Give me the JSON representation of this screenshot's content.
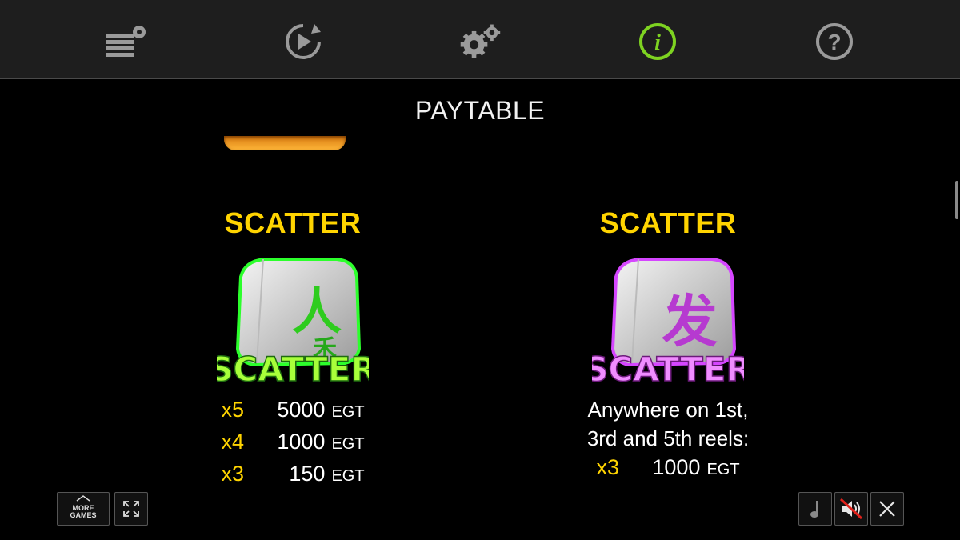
{
  "topbar": {
    "items": [
      {
        "name": "bet-settings-icon"
      },
      {
        "name": "autoplay-icon"
      },
      {
        "name": "settings-icon"
      },
      {
        "name": "info-icon",
        "active": true
      },
      {
        "name": "help-icon"
      }
    ],
    "info_symbol": "i",
    "help_symbol": "?"
  },
  "page": {
    "title": "PAYTABLE"
  },
  "symbols": [
    {
      "name": "SCATTER",
      "icon_label": "SCATTER",
      "icon_color": "#3ad12a",
      "glyphs": [
        "人",
        "禾"
      ],
      "pays": [
        {
          "mult": "x5",
          "amount": "5000",
          "currency": "EGT"
        },
        {
          "mult": "x4",
          "amount": "1000",
          "currency": "EGT"
        },
        {
          "mult": "x3",
          "amount": "150",
          "currency": "EGT"
        }
      ]
    },
    {
      "name": "SCATTER",
      "icon_label": "SCATTER",
      "icon_color": "#c13ad6",
      "glyphs": [
        "发"
      ],
      "description": [
        "Anywhere on 1st,",
        "3rd and 5th reels:"
      ],
      "pays": [
        {
          "mult": "x3",
          "amount": "1000",
          "currency": "EGT"
        }
      ]
    }
  ],
  "bottom": {
    "more_games": "MORE GAMES",
    "buttons": [
      "fullscreen-icon",
      "music-icon",
      "sound-muted-icon",
      "close-icon"
    ]
  },
  "colors": {
    "accent_yellow": "#ffd400",
    "active_icon_green": "#7ed321",
    "icon_gray": "#9a9a9a"
  }
}
